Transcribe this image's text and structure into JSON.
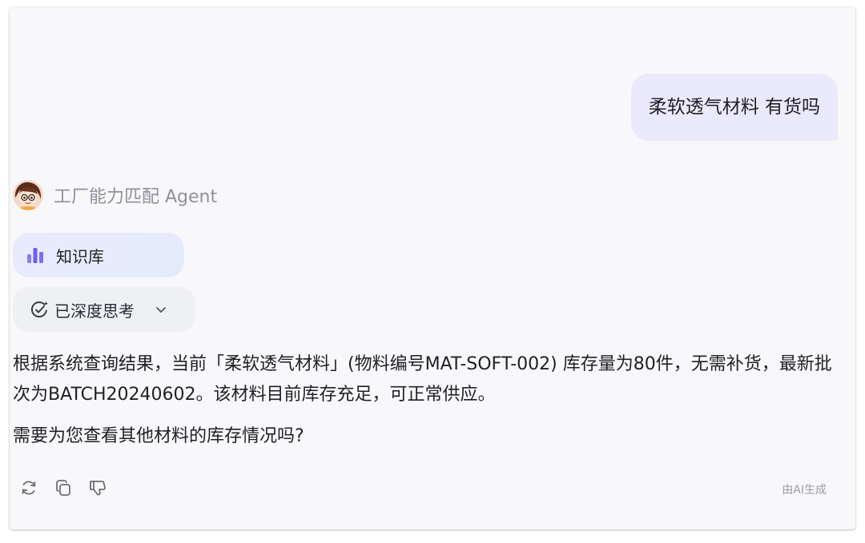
{
  "user_message": "柔软透气材料 有货吗",
  "agent": {
    "name": "工厂能力匹配 Agent",
    "avatar_icon": "avatar-girl-with-glasses"
  },
  "knowledge_base_chip": {
    "label": "知识库",
    "icon": "bar-chart-icon",
    "accent": "#6b5cf5"
  },
  "thinking_chip": {
    "label": "已深度思考",
    "icon": "deep-think-icon",
    "expand_icon": "chevron-down-icon"
  },
  "answer": {
    "paragraph1": "根据系统查询结果，当前「柔软透气材料」(物料编号MAT-SOFT-002) 库存量为80件，无需补货，最新批次为BATCH20240602。该材料目前库存充足，可正常供应。",
    "paragraph2": "需要为您查看其他材料的库存情况吗?"
  },
  "actions": {
    "icons": [
      "refresh-icon",
      "copy-icon",
      "thumbs-down-icon"
    ]
  },
  "ai_generated_note": "由AI生成",
  "colors": {
    "user_bubble": "#ebe9fc",
    "card_background": "#f8f8fb",
    "kb_chip": "#e8ebfd",
    "think_chip": "#eff0f4"
  }
}
